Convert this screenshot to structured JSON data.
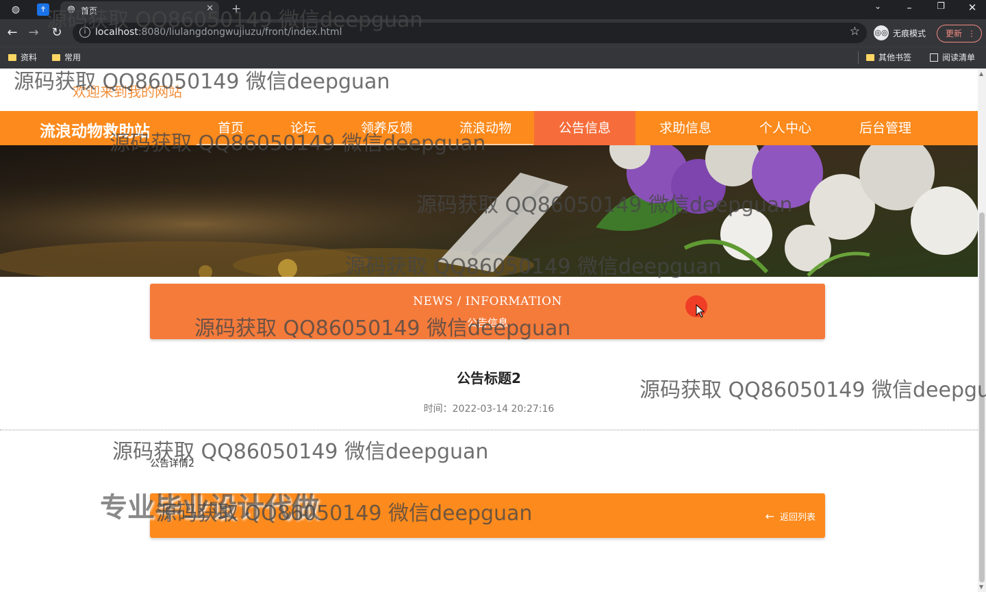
{
  "browser": {
    "tab_title": "首页",
    "url_host": "localhost",
    "url_path": ":8080/liulangdongwujiuzu/front/index.html",
    "incognito_label": "无痕模式",
    "update_label": "更新",
    "bookmarks": [
      "资料",
      "常用"
    ],
    "other_bookmarks": "其他书签",
    "reading_list": "阅读清单"
  },
  "site": {
    "welcome": "欢迎来到我的网站",
    "logo": "流浪动物救助站",
    "nav": [
      {
        "label": "首页",
        "active": false
      },
      {
        "label": "论坛",
        "active": false
      },
      {
        "label": "领养反馈",
        "active": false
      },
      {
        "label": "流浪动物",
        "active": false
      },
      {
        "label": "公告信息",
        "active": true
      },
      {
        "label": "求助信息",
        "active": false
      },
      {
        "label": "个人中心",
        "active": false
      },
      {
        "label": "后台管理",
        "active": false
      }
    ]
  },
  "section": {
    "title_en": "NEWS / INFORMATION",
    "title_cn": "公告信息"
  },
  "article": {
    "title": "公告标题2",
    "time_label": "时间：",
    "time_value": "2022-03-14 20:27:16",
    "content": "公告详情2"
  },
  "footer": {
    "back_label": "返回列表"
  },
  "watermarks": {
    "text": "源码获取 QQ86050149 微信deepguan",
    "text_cut": "源码获取 QQ86050149 微信deepgua",
    "promo": "专业毕业设计代做"
  },
  "colors": {
    "nav_orange": "#fc8a1c",
    "nav_active": "#f66d3b",
    "header_orange": "#f57b3b"
  }
}
